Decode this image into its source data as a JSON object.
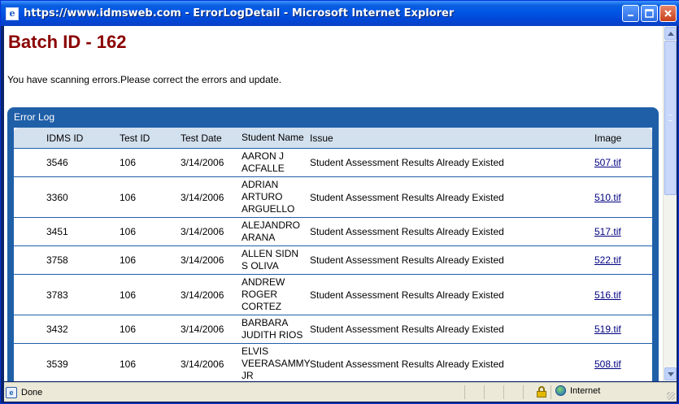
{
  "window": {
    "title": "https://www.idmsweb.com - ErrorLogDetail - Microsoft Internet Explorer",
    "icon": "ie-page-icon",
    "buttons": [
      "minimize",
      "maximize",
      "close"
    ]
  },
  "page": {
    "batch_title": "Batch ID - 162",
    "message": "You have scanning errors.Please correct the errors and update.",
    "panel_title": "Error Log"
  },
  "table": {
    "headers": {
      "idms_id": "IDMS ID",
      "test_id": "Test ID",
      "test_date": "Test Date",
      "student_name": "Student Name",
      "issue": "Issue",
      "image": "Image"
    },
    "rows": [
      {
        "idms_id": "3546",
        "test_id": "106",
        "test_date": "3/14/2006",
        "name_lines": [
          "AARON J",
          "ACFALLE"
        ],
        "issue": "Student Assessment Results Already Existed",
        "image": "507.tif"
      },
      {
        "idms_id": "3360",
        "test_id": "106",
        "test_date": "3/14/2006",
        "name_lines": [
          "ADRIAN",
          "ARTURO",
          "ARGUELLO"
        ],
        "issue": "Student Assessment Results Already Existed",
        "image": "510.tif"
      },
      {
        "idms_id": "3451",
        "test_id": "106",
        "test_date": "3/14/2006",
        "name_lines": [
          "ALEJANDRO",
          "ARANA"
        ],
        "issue": "Student Assessment Results Already Existed",
        "image": "517.tif"
      },
      {
        "idms_id": "3758",
        "test_id": "106",
        "test_date": "3/14/2006",
        "name_lines": [
          "ALLEN SIDN",
          "S OLIVA"
        ],
        "issue": "Student Assessment Results Already Existed",
        "image": "522.tif"
      },
      {
        "idms_id": "3783",
        "test_id": "106",
        "test_date": "3/14/2006",
        "name_lines": [
          "ANDREW",
          "ROGER",
          "CORTEZ"
        ],
        "issue": "Student Assessment Results Already Existed",
        "image": "516.tif"
      },
      {
        "idms_id": "3432",
        "test_id": "106",
        "test_date": "3/14/2006",
        "name_lines": [
          "BARBARA",
          "JUDITH RIOS"
        ],
        "issue": "Student Assessment Results Already Existed",
        "image": "519.tif"
      },
      {
        "idms_id": "3539",
        "test_id": "106",
        "test_date": "3/14/2006",
        "name_lines": [
          "ELVIS",
          "VEERASAMMY",
          "JR"
        ],
        "issue": "Student Assessment Results Already Existed",
        "image": "508.tif"
      }
    ]
  },
  "statusbar": {
    "status": "Done",
    "zone": "Internet"
  },
  "colors": {
    "title": "#8b0000",
    "panel": "#1f5fa8",
    "header_row": "#d3e0ee"
  }
}
